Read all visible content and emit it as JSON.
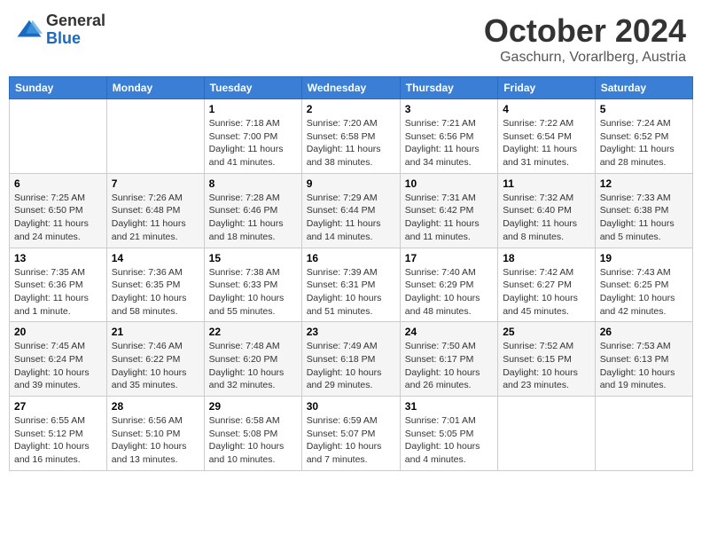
{
  "header": {
    "logo": {
      "general": "General",
      "blue": "Blue"
    },
    "title": "October 2024",
    "location": "Gaschurn, Vorarlberg, Austria"
  },
  "days_of_week": [
    "Sunday",
    "Monday",
    "Tuesday",
    "Wednesday",
    "Thursday",
    "Friday",
    "Saturday"
  ],
  "weeks": [
    [
      {
        "day": "",
        "sunrise": "",
        "sunset": "",
        "daylight": ""
      },
      {
        "day": "",
        "sunrise": "",
        "sunset": "",
        "daylight": ""
      },
      {
        "day": "1",
        "sunrise": "Sunrise: 7:18 AM",
        "sunset": "Sunset: 7:00 PM",
        "daylight": "Daylight: 11 hours and 41 minutes."
      },
      {
        "day": "2",
        "sunrise": "Sunrise: 7:20 AM",
        "sunset": "Sunset: 6:58 PM",
        "daylight": "Daylight: 11 hours and 38 minutes."
      },
      {
        "day": "3",
        "sunrise": "Sunrise: 7:21 AM",
        "sunset": "Sunset: 6:56 PM",
        "daylight": "Daylight: 11 hours and 34 minutes."
      },
      {
        "day": "4",
        "sunrise": "Sunrise: 7:22 AM",
        "sunset": "Sunset: 6:54 PM",
        "daylight": "Daylight: 11 hours and 31 minutes."
      },
      {
        "day": "5",
        "sunrise": "Sunrise: 7:24 AM",
        "sunset": "Sunset: 6:52 PM",
        "daylight": "Daylight: 11 hours and 28 minutes."
      }
    ],
    [
      {
        "day": "6",
        "sunrise": "Sunrise: 7:25 AM",
        "sunset": "Sunset: 6:50 PM",
        "daylight": "Daylight: 11 hours and 24 minutes."
      },
      {
        "day": "7",
        "sunrise": "Sunrise: 7:26 AM",
        "sunset": "Sunset: 6:48 PM",
        "daylight": "Daylight: 11 hours and 21 minutes."
      },
      {
        "day": "8",
        "sunrise": "Sunrise: 7:28 AM",
        "sunset": "Sunset: 6:46 PM",
        "daylight": "Daylight: 11 hours and 18 minutes."
      },
      {
        "day": "9",
        "sunrise": "Sunrise: 7:29 AM",
        "sunset": "Sunset: 6:44 PM",
        "daylight": "Daylight: 11 hours and 14 minutes."
      },
      {
        "day": "10",
        "sunrise": "Sunrise: 7:31 AM",
        "sunset": "Sunset: 6:42 PM",
        "daylight": "Daylight: 11 hours and 11 minutes."
      },
      {
        "day": "11",
        "sunrise": "Sunrise: 7:32 AM",
        "sunset": "Sunset: 6:40 PM",
        "daylight": "Daylight: 11 hours and 8 minutes."
      },
      {
        "day": "12",
        "sunrise": "Sunrise: 7:33 AM",
        "sunset": "Sunset: 6:38 PM",
        "daylight": "Daylight: 11 hours and 5 minutes."
      }
    ],
    [
      {
        "day": "13",
        "sunrise": "Sunrise: 7:35 AM",
        "sunset": "Sunset: 6:36 PM",
        "daylight": "Daylight: 11 hours and 1 minute."
      },
      {
        "day": "14",
        "sunrise": "Sunrise: 7:36 AM",
        "sunset": "Sunset: 6:35 PM",
        "daylight": "Daylight: 10 hours and 58 minutes."
      },
      {
        "day": "15",
        "sunrise": "Sunrise: 7:38 AM",
        "sunset": "Sunset: 6:33 PM",
        "daylight": "Daylight: 10 hours and 55 minutes."
      },
      {
        "day": "16",
        "sunrise": "Sunrise: 7:39 AM",
        "sunset": "Sunset: 6:31 PM",
        "daylight": "Daylight: 10 hours and 51 minutes."
      },
      {
        "day": "17",
        "sunrise": "Sunrise: 7:40 AM",
        "sunset": "Sunset: 6:29 PM",
        "daylight": "Daylight: 10 hours and 48 minutes."
      },
      {
        "day": "18",
        "sunrise": "Sunrise: 7:42 AM",
        "sunset": "Sunset: 6:27 PM",
        "daylight": "Daylight: 10 hours and 45 minutes."
      },
      {
        "day": "19",
        "sunrise": "Sunrise: 7:43 AM",
        "sunset": "Sunset: 6:25 PM",
        "daylight": "Daylight: 10 hours and 42 minutes."
      }
    ],
    [
      {
        "day": "20",
        "sunrise": "Sunrise: 7:45 AM",
        "sunset": "Sunset: 6:24 PM",
        "daylight": "Daylight: 10 hours and 39 minutes."
      },
      {
        "day": "21",
        "sunrise": "Sunrise: 7:46 AM",
        "sunset": "Sunset: 6:22 PM",
        "daylight": "Daylight: 10 hours and 35 minutes."
      },
      {
        "day": "22",
        "sunrise": "Sunrise: 7:48 AM",
        "sunset": "Sunset: 6:20 PM",
        "daylight": "Daylight: 10 hours and 32 minutes."
      },
      {
        "day": "23",
        "sunrise": "Sunrise: 7:49 AM",
        "sunset": "Sunset: 6:18 PM",
        "daylight": "Daylight: 10 hours and 29 minutes."
      },
      {
        "day": "24",
        "sunrise": "Sunrise: 7:50 AM",
        "sunset": "Sunset: 6:17 PM",
        "daylight": "Daylight: 10 hours and 26 minutes."
      },
      {
        "day": "25",
        "sunrise": "Sunrise: 7:52 AM",
        "sunset": "Sunset: 6:15 PM",
        "daylight": "Daylight: 10 hours and 23 minutes."
      },
      {
        "day": "26",
        "sunrise": "Sunrise: 7:53 AM",
        "sunset": "Sunset: 6:13 PM",
        "daylight": "Daylight: 10 hours and 19 minutes."
      }
    ],
    [
      {
        "day": "27",
        "sunrise": "Sunrise: 6:55 AM",
        "sunset": "Sunset: 5:12 PM",
        "daylight": "Daylight: 10 hours and 16 minutes."
      },
      {
        "day": "28",
        "sunrise": "Sunrise: 6:56 AM",
        "sunset": "Sunset: 5:10 PM",
        "daylight": "Daylight: 10 hours and 13 minutes."
      },
      {
        "day": "29",
        "sunrise": "Sunrise: 6:58 AM",
        "sunset": "Sunset: 5:08 PM",
        "daylight": "Daylight: 10 hours and 10 minutes."
      },
      {
        "day": "30",
        "sunrise": "Sunrise: 6:59 AM",
        "sunset": "Sunset: 5:07 PM",
        "daylight": "Daylight: 10 hours and 7 minutes."
      },
      {
        "day": "31",
        "sunrise": "Sunrise: 7:01 AM",
        "sunset": "Sunset: 5:05 PM",
        "daylight": "Daylight: 10 hours and 4 minutes."
      },
      {
        "day": "",
        "sunrise": "",
        "sunset": "",
        "daylight": ""
      },
      {
        "day": "",
        "sunrise": "",
        "sunset": "",
        "daylight": ""
      }
    ]
  ]
}
